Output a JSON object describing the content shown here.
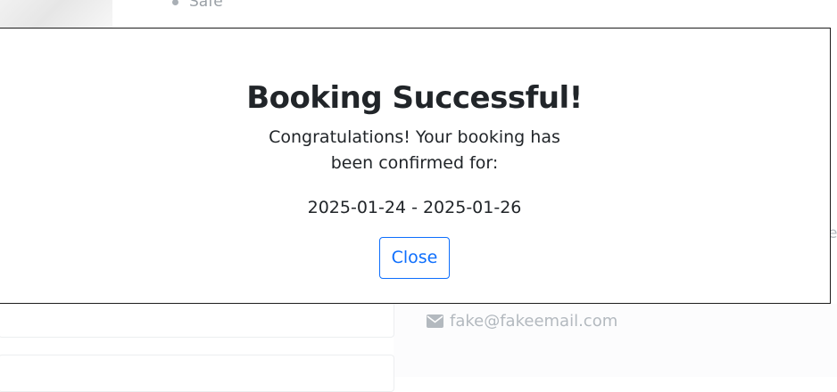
{
  "background": {
    "list_items": [
      "Safe"
    ],
    "contact_email": "fake@fakeemail.com",
    "edge_letter": "e",
    "icons": {
      "email": "envelope-icon"
    }
  },
  "modal": {
    "title": "Booking Successful!",
    "message": "Congratulations! Your booking has been confirmed for:",
    "dates": "2025-01-24 - 2025-01-26",
    "close_label": "Close"
  },
  "colors": {
    "primary": "#0d6efd",
    "text": "#212529",
    "muted": "#b3b9bf"
  }
}
